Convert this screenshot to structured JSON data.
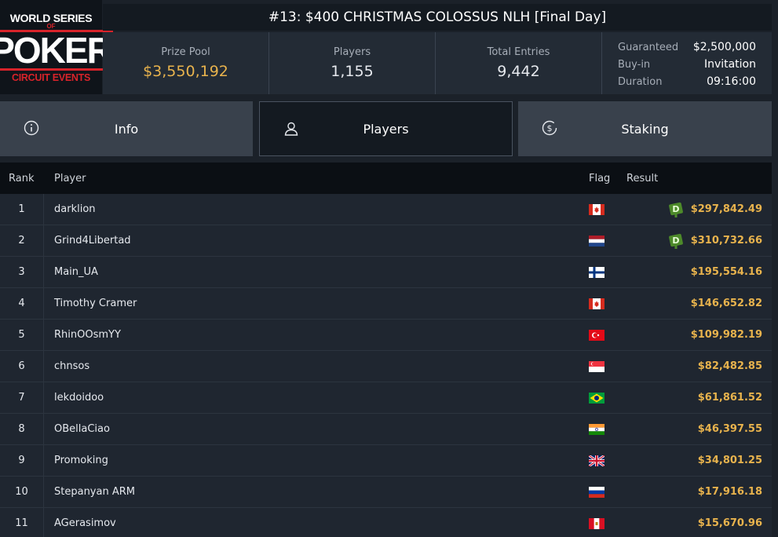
{
  "logo": {
    "line1": "WORLD SERIES",
    "line2": "OF",
    "line3": "POKER",
    "line4": "CIRCUIT EVENTS"
  },
  "title": "#13: $400 CHRISTMAS COLOSSUS NLH [Final Day]",
  "stats": {
    "prize_pool_label": "Prize Pool",
    "prize_pool_value": "$3,550,192",
    "players_label": "Players",
    "players_value": "1,155",
    "entries_label": "Total Entries",
    "entries_value": "9,442"
  },
  "meta": {
    "guaranteed_label": "Guaranteed",
    "guaranteed_value": "$2,500,000",
    "buyin_label": "Buy-in",
    "buyin_value": "Invitation",
    "duration_label": "Duration",
    "duration_value": "09:16:00"
  },
  "tabs": [
    {
      "label": "Info",
      "icon": "info-icon"
    },
    {
      "label": "Players",
      "icon": "user-icon"
    },
    {
      "label": "Staking",
      "icon": "dollar-icon"
    }
  ],
  "table": {
    "headers": {
      "rank": "Rank",
      "player": "Player",
      "flag": "Flag",
      "result": "Result"
    },
    "rows": [
      {
        "rank": "1",
        "player": "darklion",
        "flag": "canada-flag",
        "badge": "D",
        "result": "$297,842.49"
      },
      {
        "rank": "2",
        "player": "Grind4Libertad",
        "flag": "netherlands-flag",
        "badge": "D",
        "result": "$310,732.66"
      },
      {
        "rank": "3",
        "player": "Main_UA",
        "flag": "finland-flag",
        "badge": "",
        "result": "$195,554.16"
      },
      {
        "rank": "4",
        "player": "Timothy Cramer",
        "flag": "canada-flag",
        "badge": "",
        "result": "$146,652.82"
      },
      {
        "rank": "5",
        "player": "RhinOOsmYY",
        "flag": "turkey-flag",
        "badge": "",
        "result": "$109,982.19"
      },
      {
        "rank": "6",
        "player": "chnsos",
        "flag": "singapore-flag",
        "badge": "",
        "result": "$82,482.85"
      },
      {
        "rank": "7",
        "player": "lekdoidoo",
        "flag": "brazil-flag",
        "badge": "",
        "result": "$61,861.52"
      },
      {
        "rank": "8",
        "player": "OBellaCiao",
        "flag": "india-flag",
        "badge": "",
        "result": "$46,397.55"
      },
      {
        "rank": "9",
        "player": "Promoking",
        "flag": "uk-flag",
        "badge": "",
        "result": "$34,801.25"
      },
      {
        "rank": "10",
        "player": "Stepanyan ARM",
        "flag": "russia-flag",
        "badge": "",
        "result": "$17,916.18"
      },
      {
        "rank": "11",
        "player": "AGerasimov",
        "flag": "peru-flag",
        "badge": "",
        "result": "$15,670.96"
      }
    ]
  },
  "colors": {
    "gold": "#e8b34d",
    "badge_green": "#4d8a2a",
    "logo_red": "#d8232a"
  }
}
